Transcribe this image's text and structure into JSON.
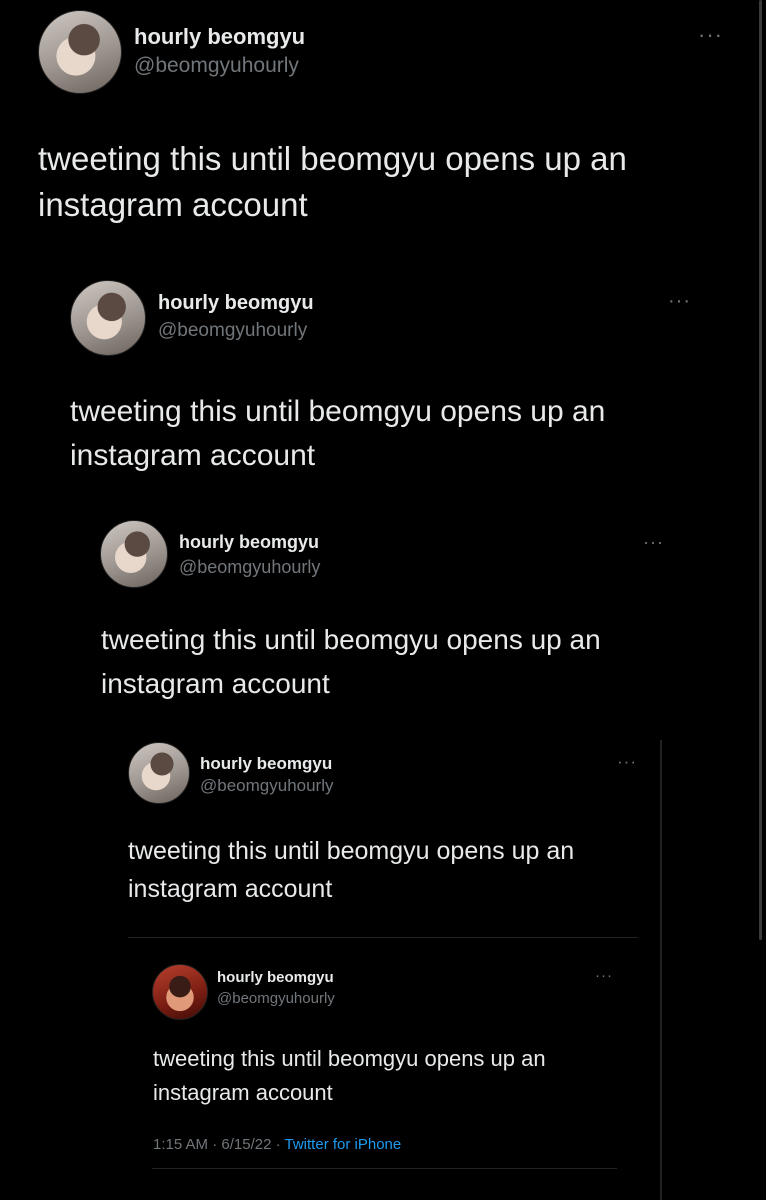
{
  "tweets": [
    {
      "name": "hourly beomgyu",
      "handle": "@beomgyuhourly",
      "more": "···",
      "text_line1": "tweeting this until beomgyu opens up an",
      "text_line2": "instagram account"
    },
    {
      "name": "hourly beomgyu",
      "handle": "@beomgyuhourly",
      "more": "···",
      "text_line1": "tweeting this until beomgyu opens up an",
      "text_line2": "instagram account"
    },
    {
      "name": "hourly beomgyu",
      "handle": "@beomgyuhourly",
      "more": "···",
      "text_line1": "tweeting this until beomgyu opens up an",
      "text_line2": "instagram account"
    },
    {
      "name": "hourly beomgyu",
      "handle": "@beomgyuhourly",
      "more": "···",
      "text_line1": "tweeting this until beomgyu opens up an",
      "text_line2": "instagram account"
    },
    {
      "name": "hourly beomgyu",
      "handle": "@beomgyuhourly",
      "more": "···",
      "text_line1": "tweeting this until beomgyu opens up an",
      "text_line2": "instagram account",
      "time": "1:15 AM",
      "date": "6/15/22",
      "source": "Twitter for iPhone"
    }
  ],
  "colors": {
    "background": "#000000",
    "text": "#e7e9ea",
    "secondary": "#71767b",
    "link": "#1d9bf0"
  }
}
